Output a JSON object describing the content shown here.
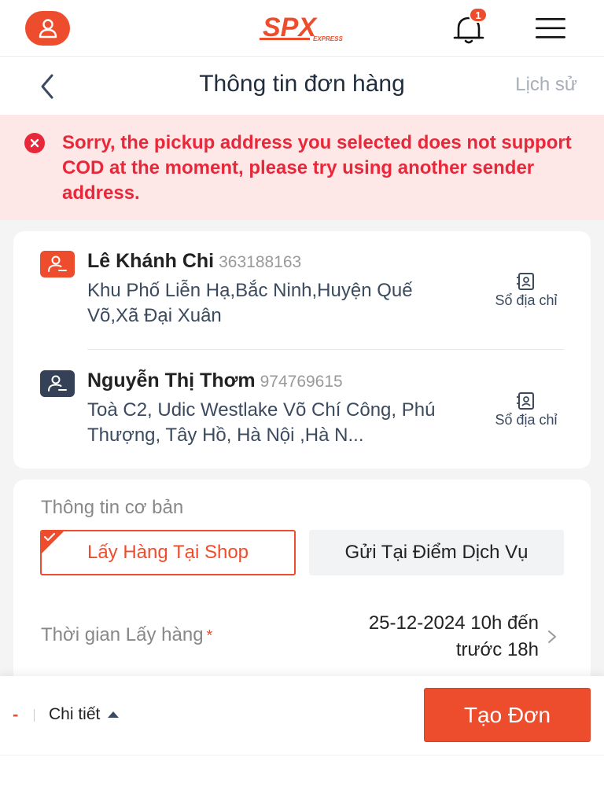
{
  "topbar": {
    "logo_text": "SPX",
    "logo_sub": "EXPRESS",
    "notification_count": "1",
    "icons": {
      "profile": "user-icon",
      "bell": "bell-icon",
      "menu": "hamburger-icon"
    }
  },
  "header": {
    "title": "Thông tin đơn hàng",
    "history_label": "Lịch sử"
  },
  "error": {
    "message": "Sorry, the pickup address you selected does not support COD at the moment, please try using another sender address."
  },
  "addresses": {
    "sender": {
      "name": "Lê Khánh Chi",
      "phone": "363188163",
      "address": "Khu Phố Liễn Hạ,Bắc Ninh,Huyện Quế Võ,Xã Đại Xuân",
      "book_label": "Sổ địa chỉ"
    },
    "receiver": {
      "name": "Nguyễn Thị Thơm",
      "phone": "974769615",
      "address": "Toà C2, Udic Westlake Võ Chí Công, Phú Thượng, Tây Hồ, Hà Nội ,Hà N...",
      "book_label": "Sổ địa chỉ"
    }
  },
  "basic_info": {
    "title": "Thông tin cơ bản",
    "options": [
      {
        "label": "Lấy Hàng Tại Shop",
        "selected": true
      },
      {
        "label": "Gửi Tại Điểm Dịch Vụ",
        "selected": false
      }
    ],
    "pickup_time_label": "Thời gian Lấy hàng",
    "required_mark": "*",
    "pickup_time_line1": "25-12-2024 10h đến",
    "pickup_time_line2": "trước 18h"
  },
  "bottom_bar": {
    "amount": "-",
    "detail_label": "Chi tiết",
    "create_label": "Tạo Đơn"
  },
  "colors": {
    "brand": "#ee4d2d",
    "error_text": "#e8283a",
    "error_bg": "#fde8e7",
    "dark_icon": "#344157"
  }
}
